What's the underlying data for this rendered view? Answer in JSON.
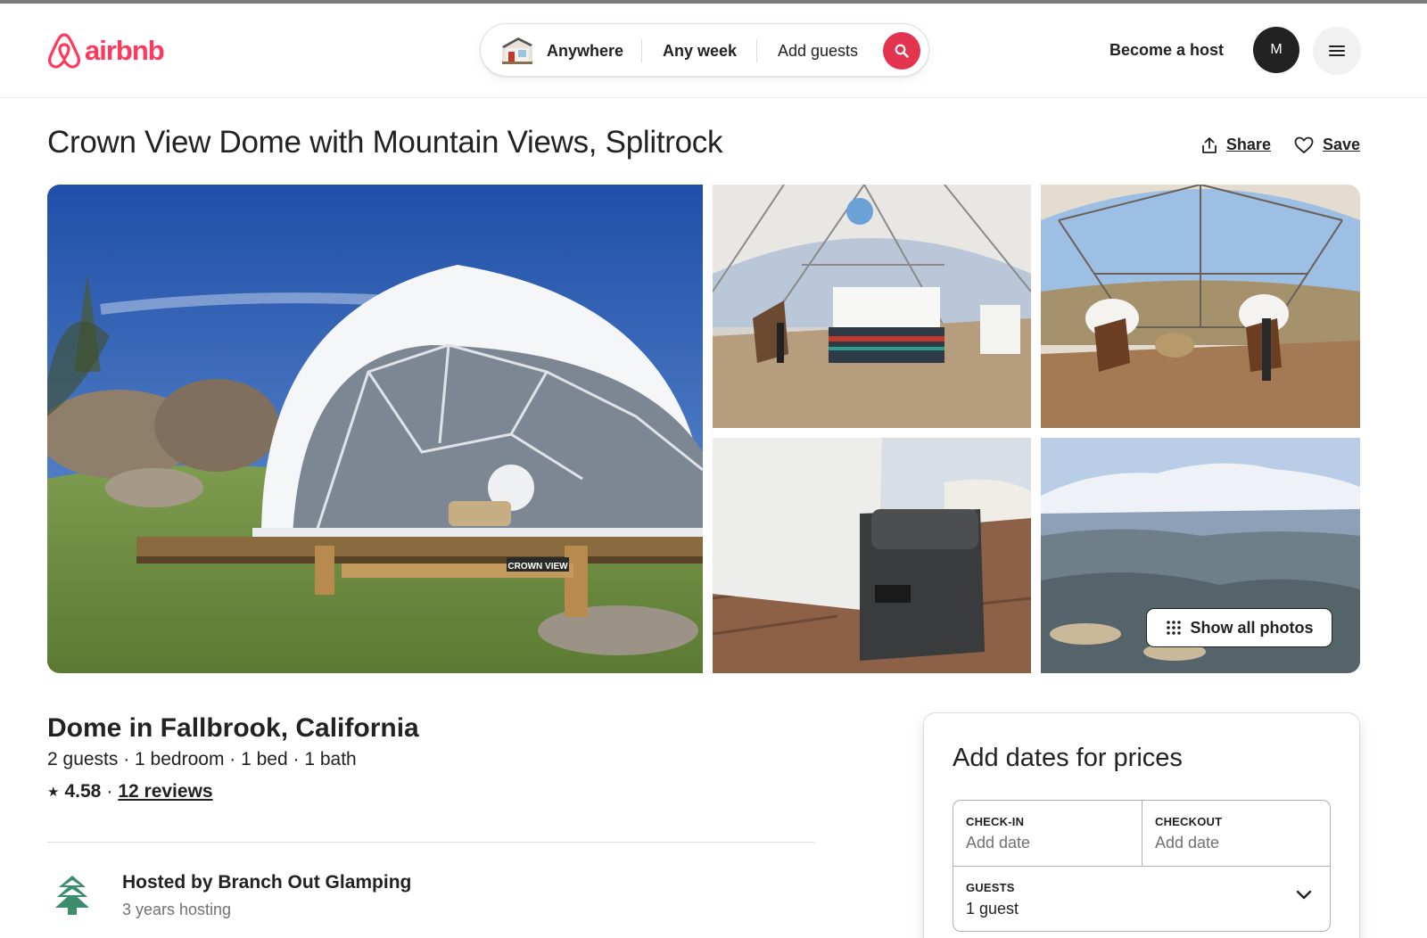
{
  "header": {
    "logo_text": "airbnb",
    "search": {
      "anywhere": "Anywhere",
      "any_week": "Any week",
      "add_guests": "Add guests"
    },
    "become_host": "Become a host",
    "avatar_initial": "M"
  },
  "listing": {
    "title": "Crown View Dome with Mountain Views, Splitrock",
    "share": "Share",
    "save": "Save",
    "show_all_photos": "Show all photos",
    "sign_text": "CROWN VIEW",
    "heading": "Dome in Fallbrook, California",
    "details": "2 guests · 1 bedroom · 1 bed · 1 bath",
    "rating_star": "★",
    "rating": "4.58",
    "separator": "·",
    "reviews": "12 reviews",
    "host_name": "Hosted by Branch Out Glamping",
    "host_years": "3 years hosting"
  },
  "booking": {
    "title": "Add dates for prices",
    "checkin_label": "CHECK-IN",
    "checkin_value": "Add date",
    "checkout_label": "CHECKOUT",
    "checkout_value": "Add date",
    "guests_label": "GUESTS",
    "guests_value": "1 guest"
  },
  "colors": {
    "brand": "#FF385C",
    "search_button": "#E3344F",
    "host_icon": "#3C8C6E"
  }
}
